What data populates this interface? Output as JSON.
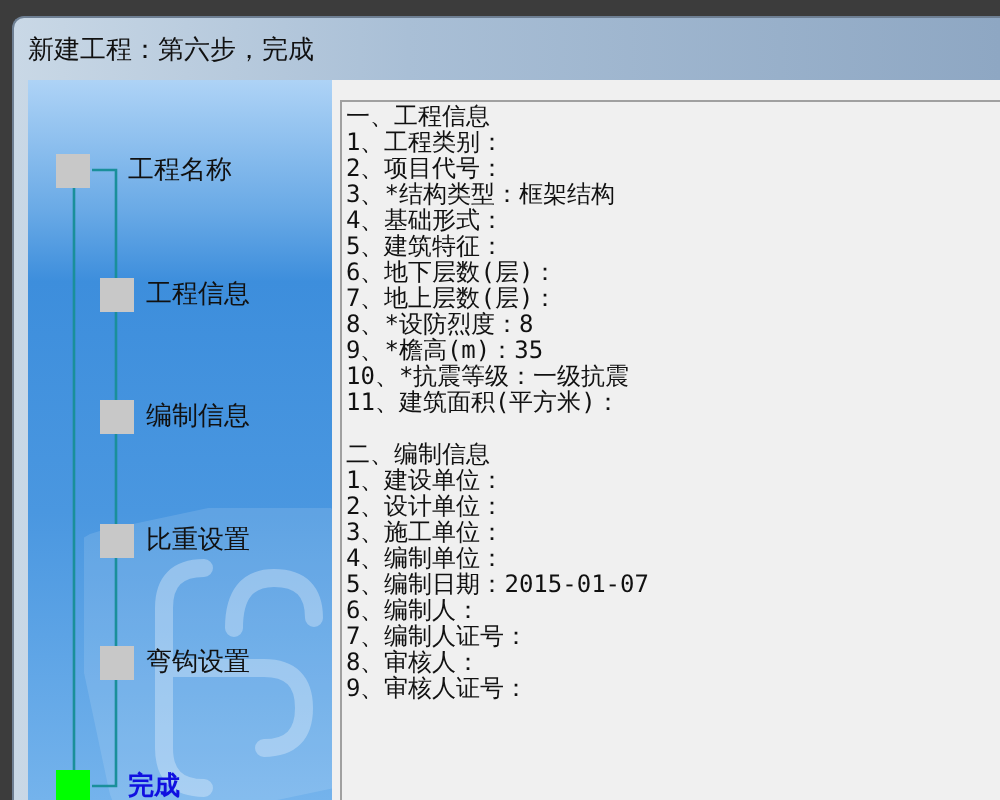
{
  "window": {
    "title": "新建工程：第六步，完成"
  },
  "steps": [
    {
      "label": "工程名称",
      "selected": false,
      "kind": "root"
    },
    {
      "label": "工程信息",
      "selected": false,
      "kind": "child"
    },
    {
      "label": "编制信息",
      "selected": false,
      "kind": "child"
    },
    {
      "label": "比重设置",
      "selected": false,
      "kind": "child"
    },
    {
      "label": "弯钩设置",
      "selected": false,
      "kind": "child"
    },
    {
      "label": "完成",
      "selected": true,
      "kind": "root"
    }
  ],
  "summary": [
    {
      "heading": "一、工程信息",
      "lines": [
        "1、工程类别：",
        "2、项目代号：",
        "3、*结构类型：框架结构",
        "4、基础形式：",
        "5、建筑特征：",
        "6、地下层数(层)：",
        "7、地上层数(层)：",
        "8、*设防烈度：8",
        "9、*檐高(m)：35",
        "10、*抗震等级：一级抗震",
        "11、建筑面积(平方米)："
      ]
    },
    {
      "heading": "二、编制信息",
      "lines": [
        "1、建设单位：",
        "2、设计单位：",
        "3、施工单位：",
        "4、编制单位：",
        "5、编制日期：2015-01-07",
        "6、编制人：",
        "7、编制人证号：",
        "8、审核人：",
        "9、审核人证号："
      ]
    }
  ]
}
